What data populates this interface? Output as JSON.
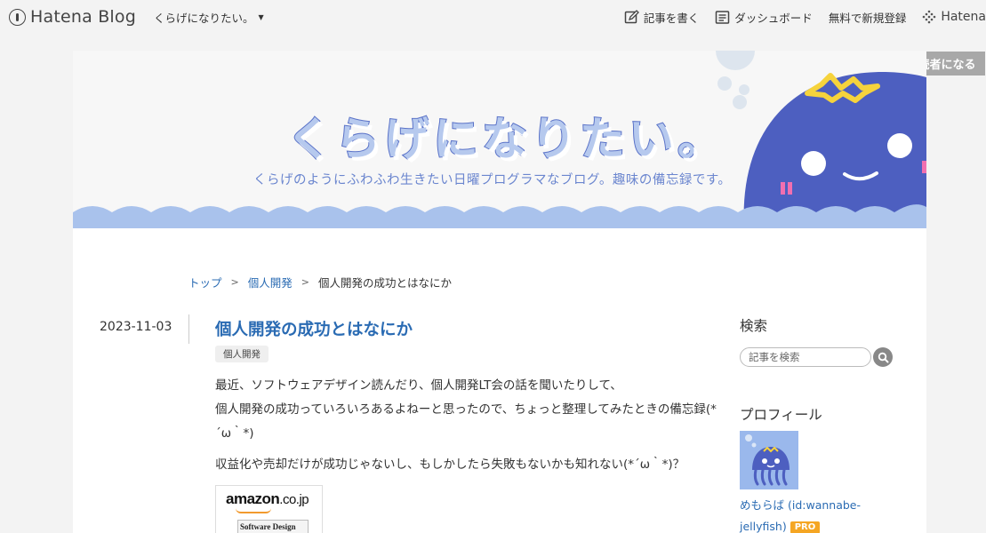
{
  "topbar": {
    "brand": "Hatena Blog",
    "blog_selector": "くらげになりたい。",
    "write_label": "記事を書く",
    "dashboard_label": "ダッシュボード",
    "signup_label": "無料で新規登録",
    "hatena_label": "Hatena"
  },
  "reader_button": "読者になる",
  "header": {
    "title": "くらげになりたい。",
    "description": "くらげのようにふわふわ生きたい日曜プログラマなブログ。趣味の備忘録です。"
  },
  "breadcrumb": {
    "top": "トップ",
    "category": "個人開発",
    "current": "個人開発の成功とはなにか",
    "separator": ">"
  },
  "entry": {
    "date": "2023-11-03",
    "title": "個人開発の成功とはなにか",
    "tag": "個人開発",
    "paragraph1_line1": "最近、ソフトウェアデザイン読んだり、個人開発LT会の話を聞いたりして、",
    "paragraph1_line2": "個人開発の成功っていろいろあるよねーと思ったので、ちょっと整理してみたときの備忘録(*´ω｀*)",
    "paragraph2": "収益化や売却だけが成功じゃないし、もしかしたら失敗もないかも知れない(*´ω｀*)？",
    "amazon_logo": "amazon",
    "amazon_domain": ".co.jp",
    "book_cover_text": "Software Design"
  },
  "sidebar": {
    "search_heading": "検索",
    "search_placeholder": "記事を検索",
    "profile_heading": "プロフィール",
    "profile_name": "めもらば (id:wannabe-jellyfish)",
    "pro_badge": "PRO"
  },
  "colors": {
    "link": "#2a6bb3",
    "header_title": "#b6c9ee",
    "header_desc": "#6b86cf",
    "jellyfish": "#4d5fc0",
    "wave": "#a9c2ec",
    "pro_badge": "#f5a623"
  }
}
